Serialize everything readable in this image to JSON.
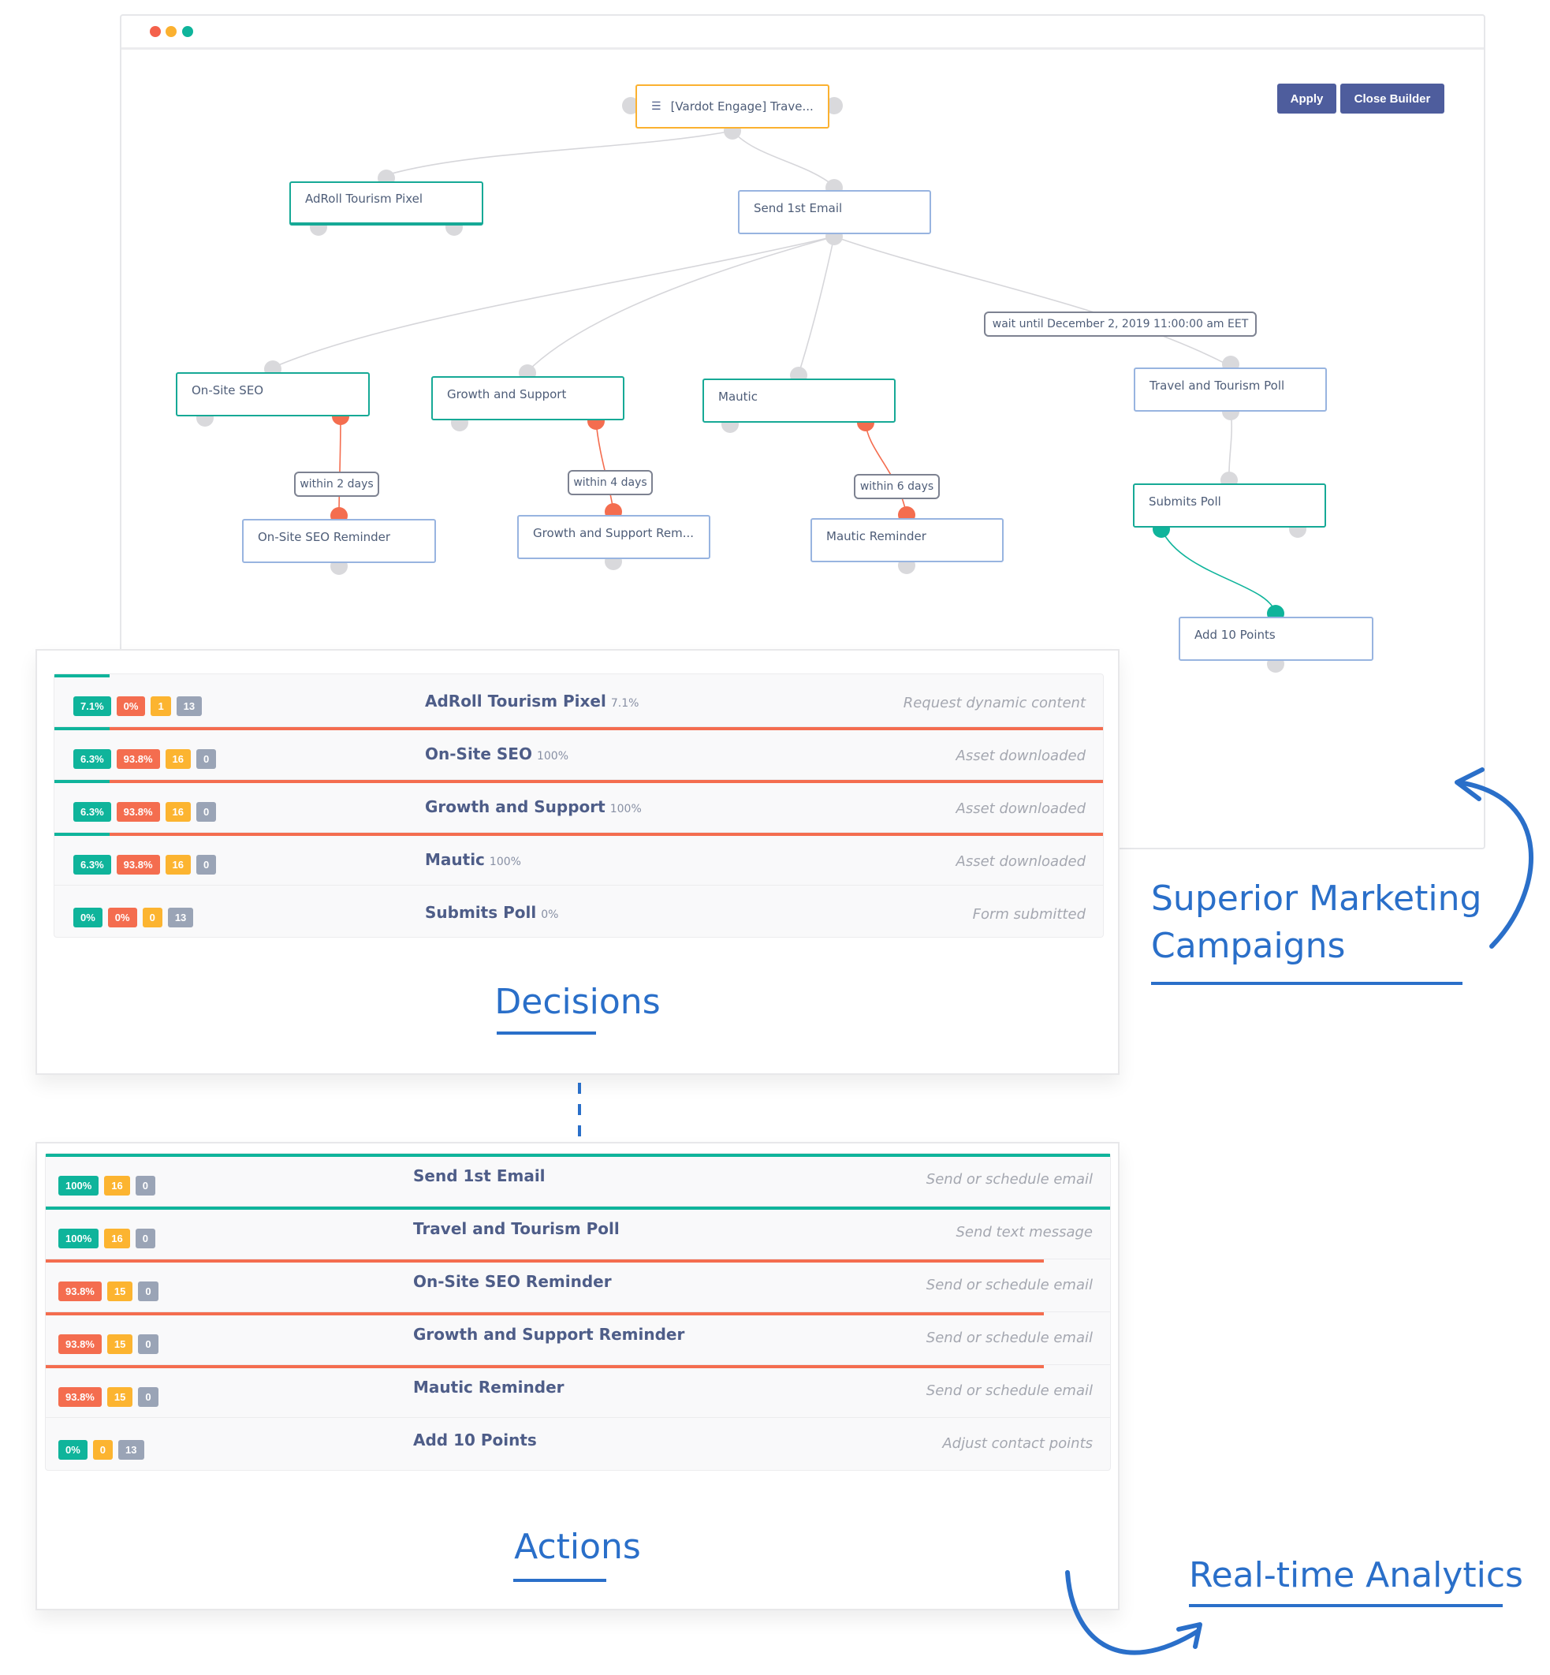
{
  "window": {
    "dots": [
      {
        "name": "close",
        "color": "#f4614b"
      },
      {
        "name": "minimize",
        "color": "#fbb130"
      },
      {
        "name": "maximize",
        "color": "#0fb49b"
      }
    ],
    "buttons": {
      "apply": "Apply",
      "close_builder": "Close Builder"
    }
  },
  "builder": {
    "root": {
      "icon": "list-icon",
      "label": "[Vardot Engage] Trave..."
    },
    "nodes": {
      "adroll": "AdRoll Tourism Pixel",
      "send_email": "Send 1st Email",
      "onsite_seo": "On-Site SEO",
      "growth": "Growth and Support",
      "mautic": "Mautic",
      "travel_poll": "Travel and Tourism Poll",
      "submits_poll": "Submits Poll",
      "add_points": "Add 10 Points",
      "onsite_reminder": "On-Site SEO Reminder",
      "growth_reminder": "Growth and Support Rem...",
      "mautic_reminder": "Mautic Reminder"
    },
    "conditions": {
      "wait": "wait until December 2, 2019 11:00:00 am EET",
      "within2": "within 2 days",
      "within4": "within 4 days",
      "within6": "within 6 days"
    }
  },
  "decisions": {
    "heading": "Decisions",
    "rows": [
      {
        "name": "AdRoll Tourism Pixel",
        "pct": "7.1%",
        "type": "Request dynamic content",
        "yes": "7.1%",
        "no": "0%",
        "count": "1",
        "pending": "13",
        "yes_fraction": 0.071,
        "no_fraction": 0
      },
      {
        "name": "On-Site SEO",
        "pct": "100%",
        "type": "Asset downloaded",
        "yes": "6.3%",
        "no": "93.8%",
        "count": "16",
        "pending": "0",
        "yes_fraction": 0.063,
        "no_fraction": 0.938
      },
      {
        "name": "Growth and Support",
        "pct": "100%",
        "type": "Asset downloaded",
        "yes": "6.3%",
        "no": "93.8%",
        "count": "16",
        "pending": "0",
        "yes_fraction": 0.063,
        "no_fraction": 0.938
      },
      {
        "name": "Mautic",
        "pct": "100%",
        "type": "Asset downloaded",
        "yes": "6.3%",
        "no": "93.8%",
        "count": "16",
        "pending": "0",
        "yes_fraction": 0.063,
        "no_fraction": 0.938
      },
      {
        "name": "Submits Poll",
        "pct": "0%",
        "type": "Form submitted",
        "yes": "0%",
        "no": "0%",
        "count": "0",
        "pending": "13",
        "yes_fraction": 0,
        "no_fraction": 0
      }
    ]
  },
  "actions": {
    "heading": "Actions",
    "rows": [
      {
        "name": "Send 1st Email",
        "type": "Send or schedule email",
        "rate": "100%",
        "rate_color": "green",
        "count": "16",
        "pending": "0",
        "fraction": 1.0
      },
      {
        "name": "Travel and Tourism Poll",
        "type": "Send text message",
        "rate": "100%",
        "rate_color": "green",
        "count": "16",
        "pending": "0",
        "fraction": 1.0
      },
      {
        "name": "On-Site SEO Reminder",
        "type": "Send or schedule email",
        "rate": "93.8%",
        "rate_color": "red",
        "count": "15",
        "pending": "0",
        "fraction": 0.938
      },
      {
        "name": "Growth and Support Reminder",
        "type": "Send or schedule email",
        "rate": "93.8%",
        "rate_color": "red",
        "count": "15",
        "pending": "0",
        "fraction": 0.938
      },
      {
        "name": "Mautic Reminder",
        "type": "Send or schedule email",
        "rate": "93.8%",
        "rate_color": "red",
        "count": "15",
        "pending": "0",
        "fraction": 0.938
      },
      {
        "name": "Add 10 Points",
        "type": "Adjust contact points",
        "rate": "0%",
        "rate_color": "green",
        "count": "0",
        "pending": "13",
        "fraction": 0
      }
    ]
  },
  "annotations": {
    "superior_line1": "Superior Marketing",
    "superior_line2": "Campaigns",
    "realtime": "Real-time Analytics"
  },
  "colors": {
    "green": "#0fb49b",
    "red": "#f46d4f",
    "yellow": "#fcb430",
    "gray": "#9aa4b6",
    "accent": "#2a6fc9",
    "button": "#4e5d9d"
  }
}
